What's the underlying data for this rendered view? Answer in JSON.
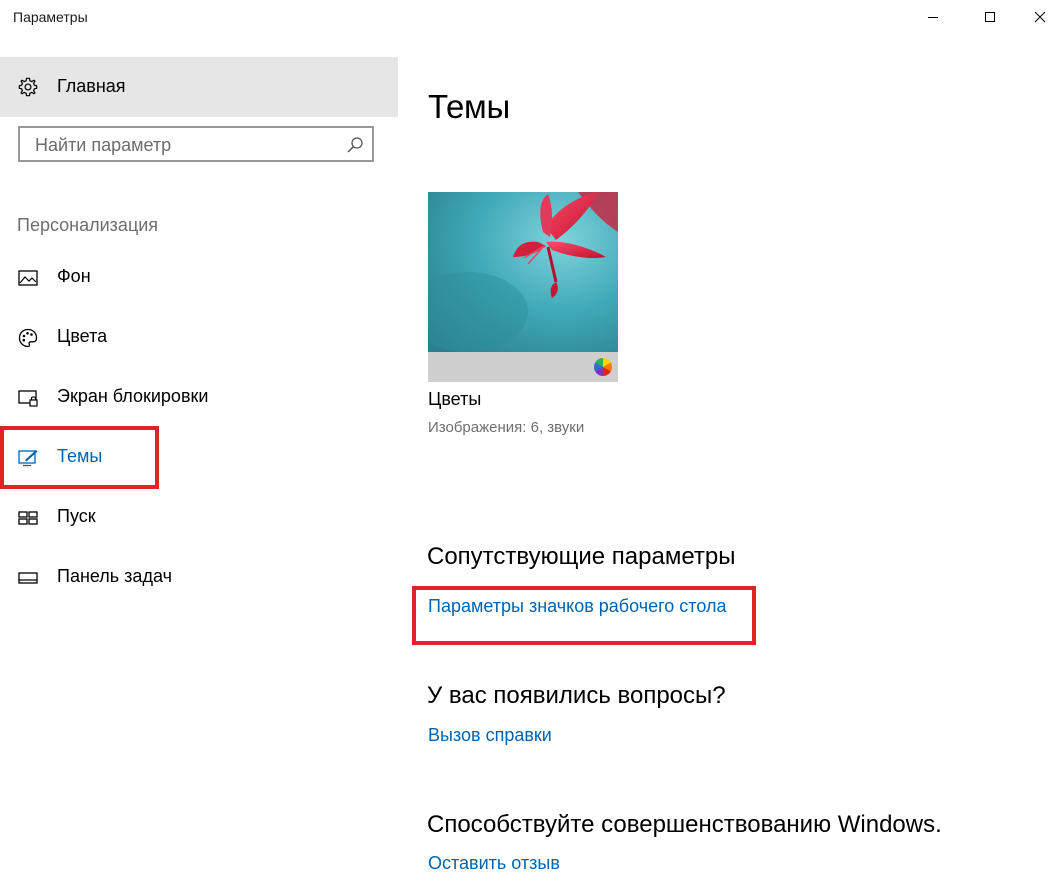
{
  "window": {
    "title": "Параметры",
    "minimize_icon": "minimize-icon",
    "maximize_icon": "maximize-icon",
    "close_icon": "close-icon"
  },
  "sidebar": {
    "home": {
      "label": "Главная",
      "icon": "gear-icon"
    },
    "search": {
      "placeholder": "Найти параметр",
      "icon": "search-icon"
    },
    "section": "Персонализация",
    "items": [
      {
        "label": "Фон",
        "icon": "picture-icon"
      },
      {
        "label": "Цвета",
        "icon": "palette-icon"
      },
      {
        "label": "Экран блокировки",
        "icon": "lock-screen-icon"
      },
      {
        "label": "Темы",
        "icon": "themes-icon",
        "active": true
      },
      {
        "label": "Пуск",
        "icon": "start-icon"
      },
      {
        "label": "Панель задач",
        "icon": "taskbar-icon"
      }
    ]
  },
  "main": {
    "title": "Темы",
    "theme": {
      "name": "Цветы",
      "meta": "Изображения: 6, звуки"
    },
    "related": {
      "heading": "Сопутствующие параметры",
      "link": "Параметры значков рабочего стола"
    },
    "questions": {
      "heading": "У вас появились вопросы?",
      "link": "Вызов справки"
    },
    "improve": {
      "heading": "Способствуйте совершенствованию Windows.",
      "link": "Оставить отзыв"
    }
  },
  "colors": {
    "accent": "#0063b1",
    "highlight": "#e02229",
    "home_bg": "#e6e6e6"
  }
}
